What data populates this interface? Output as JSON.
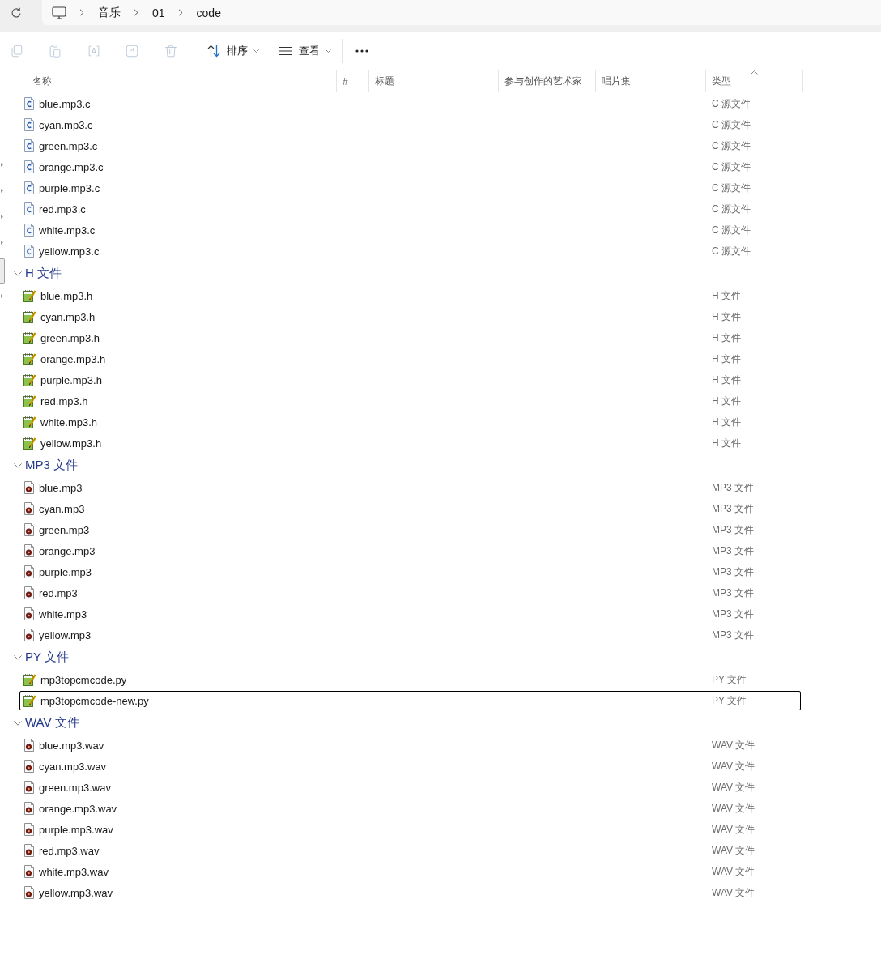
{
  "address_bar": {
    "path": [
      "音乐",
      "01",
      "code"
    ]
  },
  "toolbar": {
    "actions": [
      {
        "kind": "copy",
        "disabled": true
      },
      {
        "kind": "paste",
        "disabled": true
      },
      {
        "kind": "rename",
        "disabled": true
      },
      {
        "kind": "share",
        "disabled": true
      },
      {
        "kind": "delete",
        "disabled": true
      }
    ],
    "sort": {
      "label": "排序"
    },
    "view": {
      "label": "查看"
    }
  },
  "columns": [
    {
      "label": "名称",
      "sorted": false
    },
    {
      "label": "#",
      "sorted": false
    },
    {
      "label": "标题",
      "sorted": false
    },
    {
      "label": "参与创作的艺术家",
      "sorted": false
    },
    {
      "label": "唱片集",
      "sorted": false
    },
    {
      "label": "类型",
      "sorted": true
    }
  ],
  "groups": [
    {
      "files": [
        {
          "name": "blue.mp3.c",
          "type": "C 源文件",
          "kind": "csource",
          "focused": false
        },
        {
          "name": "cyan.mp3.c",
          "type": "C 源文件",
          "kind": "csource",
          "focused": false
        },
        {
          "name": "green.mp3.c",
          "type": "C 源文件",
          "kind": "csource",
          "focused": false
        },
        {
          "name": "orange.mp3.c",
          "type": "C 源文件",
          "kind": "csource",
          "focused": false
        },
        {
          "name": "purple.mp3.c",
          "type": "C 源文件",
          "kind": "csource",
          "focused": false
        },
        {
          "name": "red.mp3.c",
          "type": "C 源文件",
          "kind": "csource",
          "focused": false
        },
        {
          "name": "white.mp3.c",
          "type": "C 源文件",
          "kind": "csource",
          "focused": false
        },
        {
          "name": "yellow.mp3.c",
          "type": "C 源文件",
          "kind": "csource",
          "focused": false
        }
      ]
    },
    {
      "label": "H 文件",
      "expanded": true,
      "files": [
        {
          "name": "blue.mp3.h",
          "type": "H 文件",
          "kind": "notepad",
          "focused": false
        },
        {
          "name": "cyan.mp3.h",
          "type": "H 文件",
          "kind": "notepad",
          "focused": false
        },
        {
          "name": "green.mp3.h",
          "type": "H 文件",
          "kind": "notepad",
          "focused": false
        },
        {
          "name": "orange.mp3.h",
          "type": "H 文件",
          "kind": "notepad",
          "focused": false
        },
        {
          "name": "purple.mp3.h",
          "type": "H 文件",
          "kind": "notepad",
          "focused": false
        },
        {
          "name": "red.mp3.h",
          "type": "H 文件",
          "kind": "notepad",
          "focused": false
        },
        {
          "name": "white.mp3.h",
          "type": "H 文件",
          "kind": "notepad",
          "focused": false
        },
        {
          "name": "yellow.mp3.h",
          "type": "H 文件",
          "kind": "notepad",
          "focused": false
        }
      ]
    },
    {
      "label": "MP3 文件",
      "expanded": true,
      "files": [
        {
          "name": "blue.mp3",
          "type": "MP3 文件",
          "kind": "audio",
          "focused": false
        },
        {
          "name": "cyan.mp3",
          "type": "MP3 文件",
          "kind": "audio",
          "focused": false
        },
        {
          "name": "green.mp3",
          "type": "MP3 文件",
          "kind": "audio",
          "focused": false
        },
        {
          "name": "orange.mp3",
          "type": "MP3 文件",
          "kind": "audio",
          "focused": false
        },
        {
          "name": "purple.mp3",
          "type": "MP3 文件",
          "kind": "audio",
          "focused": false
        },
        {
          "name": "red.mp3",
          "type": "MP3 文件",
          "kind": "audio",
          "focused": false
        },
        {
          "name": "white.mp3",
          "type": "MP3 文件",
          "kind": "audio",
          "focused": false
        },
        {
          "name": "yellow.mp3",
          "type": "MP3 文件",
          "kind": "audio",
          "focused": false
        }
      ]
    },
    {
      "label": "PY 文件",
      "expanded": true,
      "files": [
        {
          "name": "mp3topcmcode.py",
          "type": "PY 文件",
          "kind": "notepad",
          "focused": false
        },
        {
          "name": "mp3topcmcode-new.py",
          "type": "PY 文件",
          "kind": "notepad",
          "focused": true
        }
      ]
    },
    {
      "label": "WAV 文件",
      "expanded": true,
      "files": [
        {
          "name": "blue.mp3.wav",
          "type": "WAV 文件",
          "kind": "audio",
          "focused": false
        },
        {
          "name": "cyan.mp3.wav",
          "type": "WAV 文件",
          "kind": "audio",
          "focused": false
        },
        {
          "name": "green.mp3.wav",
          "type": "WAV 文件",
          "kind": "audio",
          "focused": false
        },
        {
          "name": "orange.mp3.wav",
          "type": "WAV 文件",
          "kind": "audio",
          "focused": false
        },
        {
          "name": "purple.mp3.wav",
          "type": "WAV 文件",
          "kind": "audio",
          "focused": false
        },
        {
          "name": "red.mp3.wav",
          "type": "WAV 文件",
          "kind": "audio",
          "focused": false
        },
        {
          "name": "white.mp3.wav",
          "type": "WAV 文件",
          "kind": "audio",
          "focused": false
        },
        {
          "name": "yellow.mp3.wav",
          "type": "WAV 文件",
          "kind": "audio",
          "focused": false
        }
      ]
    }
  ]
}
